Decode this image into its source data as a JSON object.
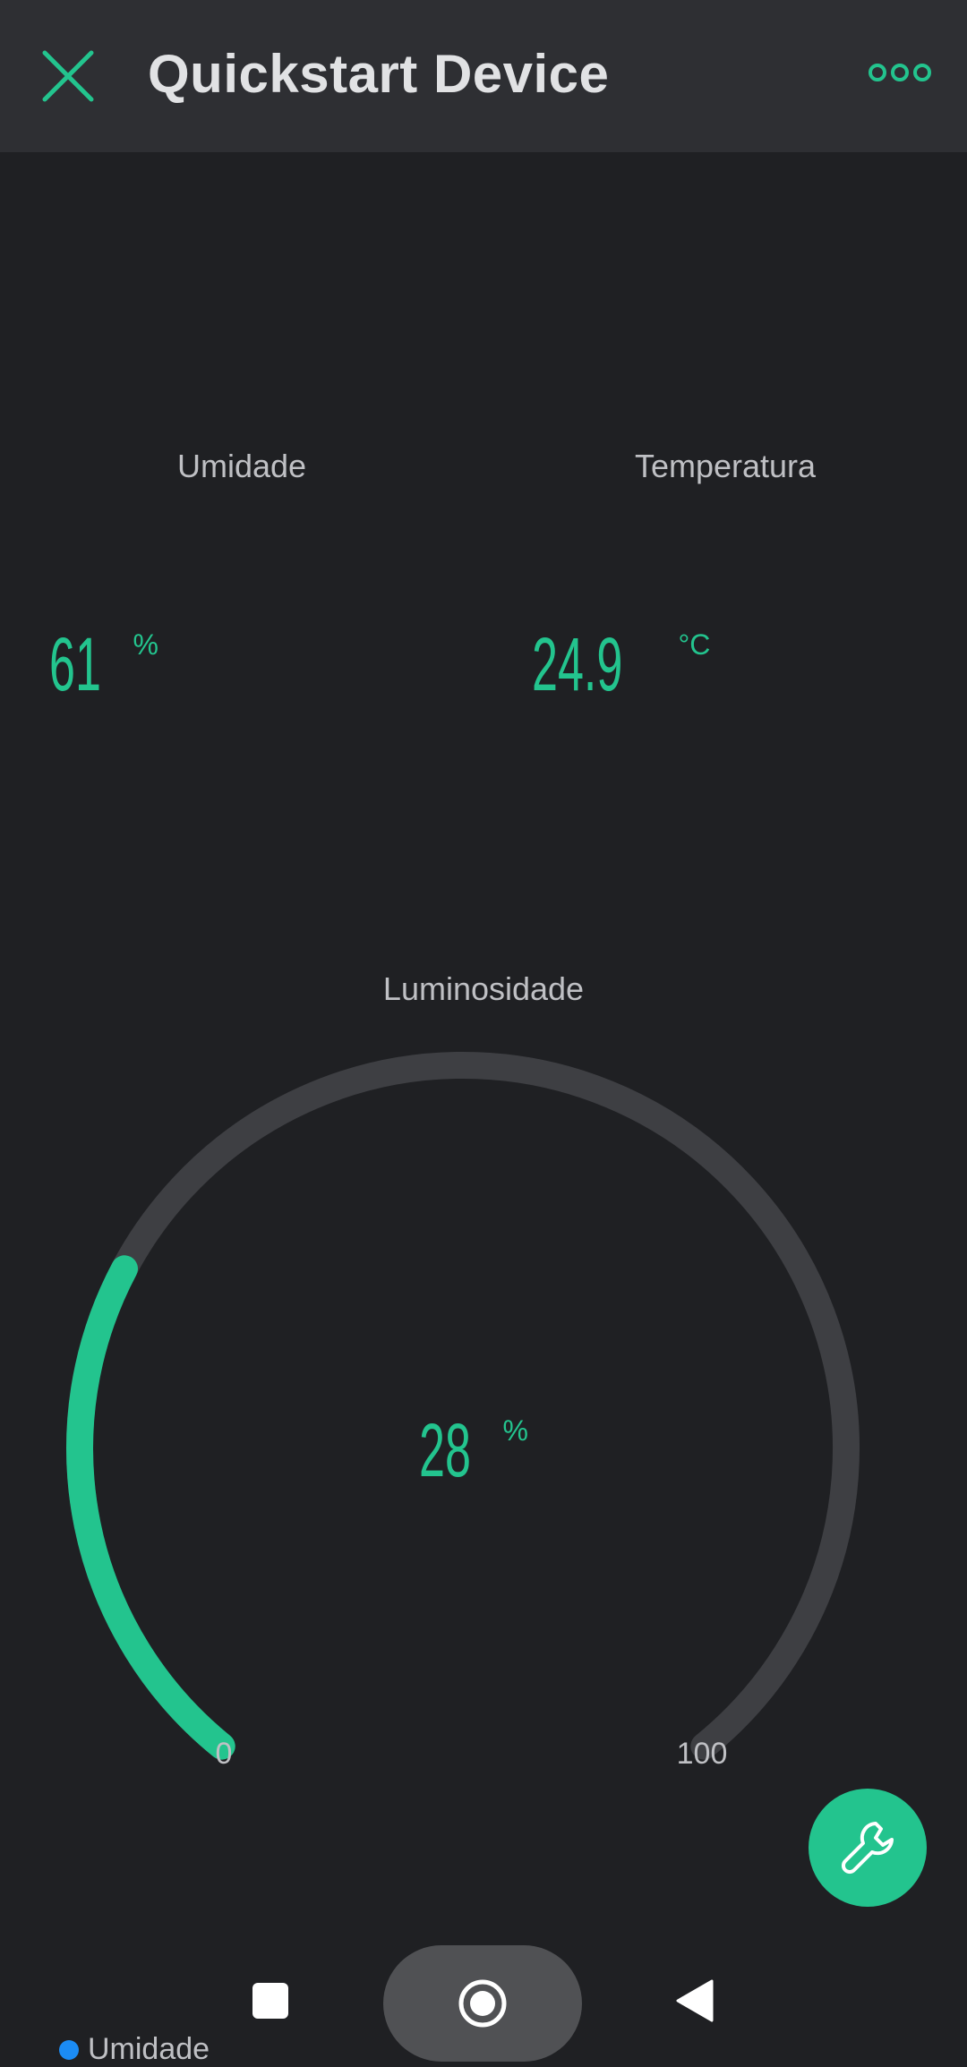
{
  "app_bar": {
    "title": "Quickstart Device",
    "close_icon": "close-icon",
    "menu_icon": "more-options-icon"
  },
  "widgets": {
    "umidade": {
      "label": "Umidade",
      "value": "61",
      "unit": "%"
    },
    "temperatura": {
      "label": "Temperatura",
      "value": "24.9",
      "unit": "°C"
    },
    "luminosidade": {
      "label": "Luminosidade",
      "value": "28",
      "unit": "%",
      "min": "0",
      "max": "100",
      "level_percent": 28
    }
  },
  "fab": {
    "icon": "wrench-icon"
  },
  "navigation_bar": {
    "recents_icon": "recents-icon",
    "home_icon": "home-icon",
    "back_icon": "back-icon"
  },
  "legend": {
    "series": "Umidade"
  },
  "colors": {
    "accent": "#23c48e",
    "background": "#1f2023",
    "app_bar": "#2e2f33",
    "gauge_track": "#3e3f43",
    "legend_dot": "#1b8cf5"
  }
}
